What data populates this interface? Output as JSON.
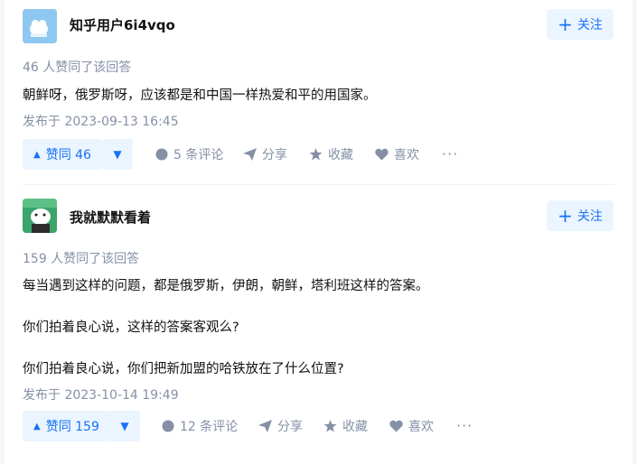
{
  "answers": [
    {
      "author": "知乎用户6i4vqo",
      "follow_label": "关注",
      "votes_text": "46 人赞同了该回答",
      "paragraphs": [
        "朝鲜呀，俄罗斯呀，应该都是和中国一样热爱和平的用国家。"
      ],
      "date": "发布于 2023-09-13 16:45",
      "vote_label": "赞同 46",
      "comments": "5 条评论",
      "share": "分享",
      "collect": "收藏",
      "like": "喜欢",
      "more": "···",
      "avatar_color": "#8ec7f0"
    },
    {
      "author": "我就默默看着",
      "follow_label": "关注",
      "votes_text": "159 人赞同了该回答",
      "paragraphs": [
        "每当遇到这样的问题，都是俄罗斯，伊朗，朝鲜，塔利班这样的答案。",
        "你们拍着良心说，这样的答案客观么?",
        "你们拍着良心说，你们把新加盟的哈铁放在了什么位置?"
      ],
      "date": "发布于 2023-10-14 19:49",
      "vote_label": "赞同 159",
      "comments": "12 条评论",
      "share": "分享",
      "collect": "收藏",
      "like": "喜欢",
      "more": "···",
      "avatar_color": "#3aa46a"
    }
  ],
  "colors": {
    "accent": "#1772f6",
    "accent_bg": "#ebf5ff",
    "meta": "#8590a6",
    "text": "#121212"
  }
}
